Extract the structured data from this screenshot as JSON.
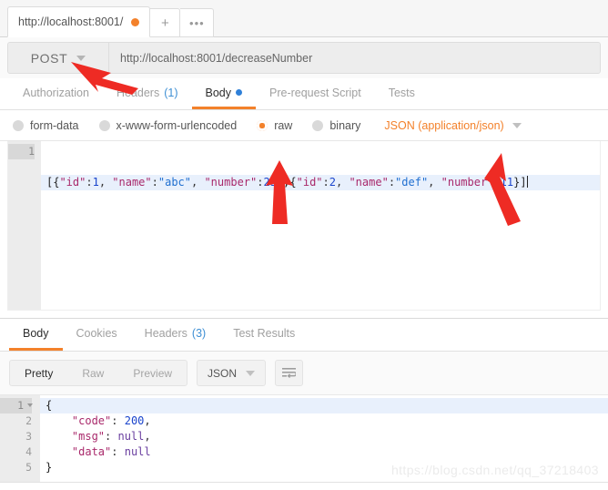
{
  "window": {
    "tab": {
      "label": "http://localhost:8001/",
      "unsaved_indicator": "unsaved-dot",
      "new_tab_label": "+",
      "more_label": "•••"
    }
  },
  "request": {
    "method": "POST",
    "method_caret_icon": "chevron-down-icon",
    "url": "http://localhost:8001/decreaseNumber",
    "tabs": [
      {
        "label": "Authorization",
        "active": false,
        "badge": ""
      },
      {
        "label": "Headers",
        "active": false,
        "badge": "(1)"
      },
      {
        "label": "Body",
        "active": true,
        "badge": ""
      },
      {
        "label": "Pre-request Script",
        "active": false,
        "badge": ""
      },
      {
        "label": "Tests",
        "active": false,
        "badge": ""
      }
    ],
    "body_modes": [
      {
        "label": "form-data",
        "selected": false
      },
      {
        "label": "x-www-form-urlencoded",
        "selected": false
      },
      {
        "label": "raw",
        "selected": true
      },
      {
        "label": "binary",
        "selected": false
      }
    ],
    "content_type": "JSON (application/json)",
    "content_type_caret_icon": "chevron-down-icon",
    "editor": {
      "line_numbers": [
        "1"
      ],
      "raw_text": "[{\"id\":1, \"name\":\"abc\", \"number\":23},{\"id\":2, \"name\":\"def\", \"number\":11}]",
      "tokens": [
        {
          "t": "[{",
          "c": "tk-brace"
        },
        {
          "t": "\"id\"",
          "c": "tk-key"
        },
        {
          "t": ":",
          "c": "tk-punc"
        },
        {
          "t": "1",
          "c": "tk-num"
        },
        {
          "t": ", ",
          "c": "tk-punc"
        },
        {
          "t": "\"name\"",
          "c": "tk-key"
        },
        {
          "t": ":",
          "c": "tk-punc"
        },
        {
          "t": "\"abc\"",
          "c": "tk-str"
        },
        {
          "t": ", ",
          "c": "tk-punc"
        },
        {
          "t": "\"number\"",
          "c": "tk-key"
        },
        {
          "t": ":",
          "c": "tk-punc"
        },
        {
          "t": "23",
          "c": "tk-num"
        },
        {
          "t": "},{",
          "c": "tk-brace"
        },
        {
          "t": "\"id\"",
          "c": "tk-key"
        },
        {
          "t": ":",
          "c": "tk-punc"
        },
        {
          "t": "2",
          "c": "tk-num"
        },
        {
          "t": ", ",
          "c": "tk-punc"
        },
        {
          "t": "\"name\"",
          "c": "tk-key"
        },
        {
          "t": ":",
          "c": "tk-punc"
        },
        {
          "t": "\"def\"",
          "c": "tk-str"
        },
        {
          "t": ", ",
          "c": "tk-punc"
        },
        {
          "t": "\"number\"",
          "c": "tk-key"
        },
        {
          "t": ":",
          "c": "tk-punc"
        },
        {
          "t": "11",
          "c": "tk-num"
        },
        {
          "t": "}]",
          "c": "tk-brace"
        }
      ]
    }
  },
  "response": {
    "tabs": [
      {
        "label": "Body",
        "active": true,
        "badge": ""
      },
      {
        "label": "Cookies",
        "active": false,
        "badge": ""
      },
      {
        "label": "Headers",
        "active": false,
        "badge": "(3)"
      },
      {
        "label": "Test Results",
        "active": false,
        "badge": ""
      }
    ],
    "view_modes": [
      {
        "label": "Pretty",
        "active": true
      },
      {
        "label": "Raw",
        "active": false
      },
      {
        "label": "Preview",
        "active": false
      }
    ],
    "format": "JSON",
    "format_caret_icon": "chevron-down-icon",
    "wrap_icon": "word-wrap-icon",
    "editor": {
      "line_numbers": [
        "1",
        "2",
        "3",
        "4",
        "5"
      ],
      "lines": [
        {
          "indent": 0,
          "tokens": [
            {
              "t": "{",
              "c": "tk-brace"
            }
          ]
        },
        {
          "indent": 4,
          "tokens": [
            {
              "t": "\"code\"",
              "c": "tk-key"
            },
            {
              "t": ": ",
              "c": "tk-punc"
            },
            {
              "t": "200",
              "c": "tk-num"
            },
            {
              "t": ",",
              "c": "tk-punc"
            }
          ]
        },
        {
          "indent": 4,
          "tokens": [
            {
              "t": "\"msg\"",
              "c": "tk-key"
            },
            {
              "t": ": ",
              "c": "tk-punc"
            },
            {
              "t": "null",
              "c": "tk-null"
            },
            {
              "t": ",",
              "c": "tk-punc"
            }
          ]
        },
        {
          "indent": 4,
          "tokens": [
            {
              "t": "\"data\"",
              "c": "tk-key"
            },
            {
              "t": ": ",
              "c": "tk-punc"
            },
            {
              "t": "null",
              "c": "tk-null"
            }
          ]
        },
        {
          "indent": 0,
          "tokens": [
            {
              "t": "}",
              "c": "tk-brace"
            }
          ]
        }
      ]
    }
  },
  "annotations": {
    "arrow_color": "#ee2b24",
    "arrows": [
      {
        "name": "arrow-to-method",
        "points_at": "POST method selector"
      },
      {
        "name": "arrow-to-raw-radio",
        "points_at": "raw body type radio"
      },
      {
        "name": "arrow-to-content-type",
        "points_at": "JSON (application/json) selector"
      }
    ]
  },
  "watermark": {
    "text": "https://blog.csdn.net/qq_37218403"
  }
}
